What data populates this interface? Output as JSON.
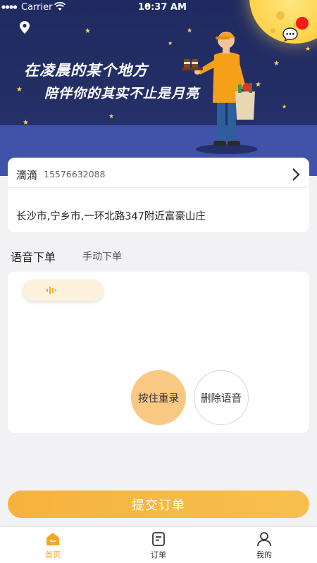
{
  "status_bar": {
    "carrier": "Carrier",
    "time": "10:37 AM"
  },
  "hero": {
    "slogan_line1": "在凌晨的某个地方",
    "slogan_line2": "陪伴你的其实不止是月亮",
    "icons": [
      "location-pin-icon",
      "chat-bubble-icon"
    ]
  },
  "address": {
    "name": "滴滴",
    "phone": "15576632088",
    "detail": "长沙市,宁乡市,一环北路347附近富豪山庄"
  },
  "order_tabs": {
    "voice": "语音下单",
    "manual": "手动下单",
    "active": "voice"
  },
  "voice_panel": {
    "rerecord_label": "按住重录",
    "delete_label": "删除语音"
  },
  "submit_label": "提交订单",
  "tab_bar": {
    "items": [
      {
        "label": "首页",
        "icon": "home-icon",
        "active": true
      },
      {
        "label": "订单",
        "icon": "order-icon",
        "active": false
      },
      {
        "label": "我的",
        "icon": "profile-icon",
        "active": false
      }
    ]
  },
  "colors": {
    "accent": "#f5a623",
    "hero_bg": "#222d62",
    "moon": "#ffd24a",
    "red_dot": "#f21c1c"
  }
}
